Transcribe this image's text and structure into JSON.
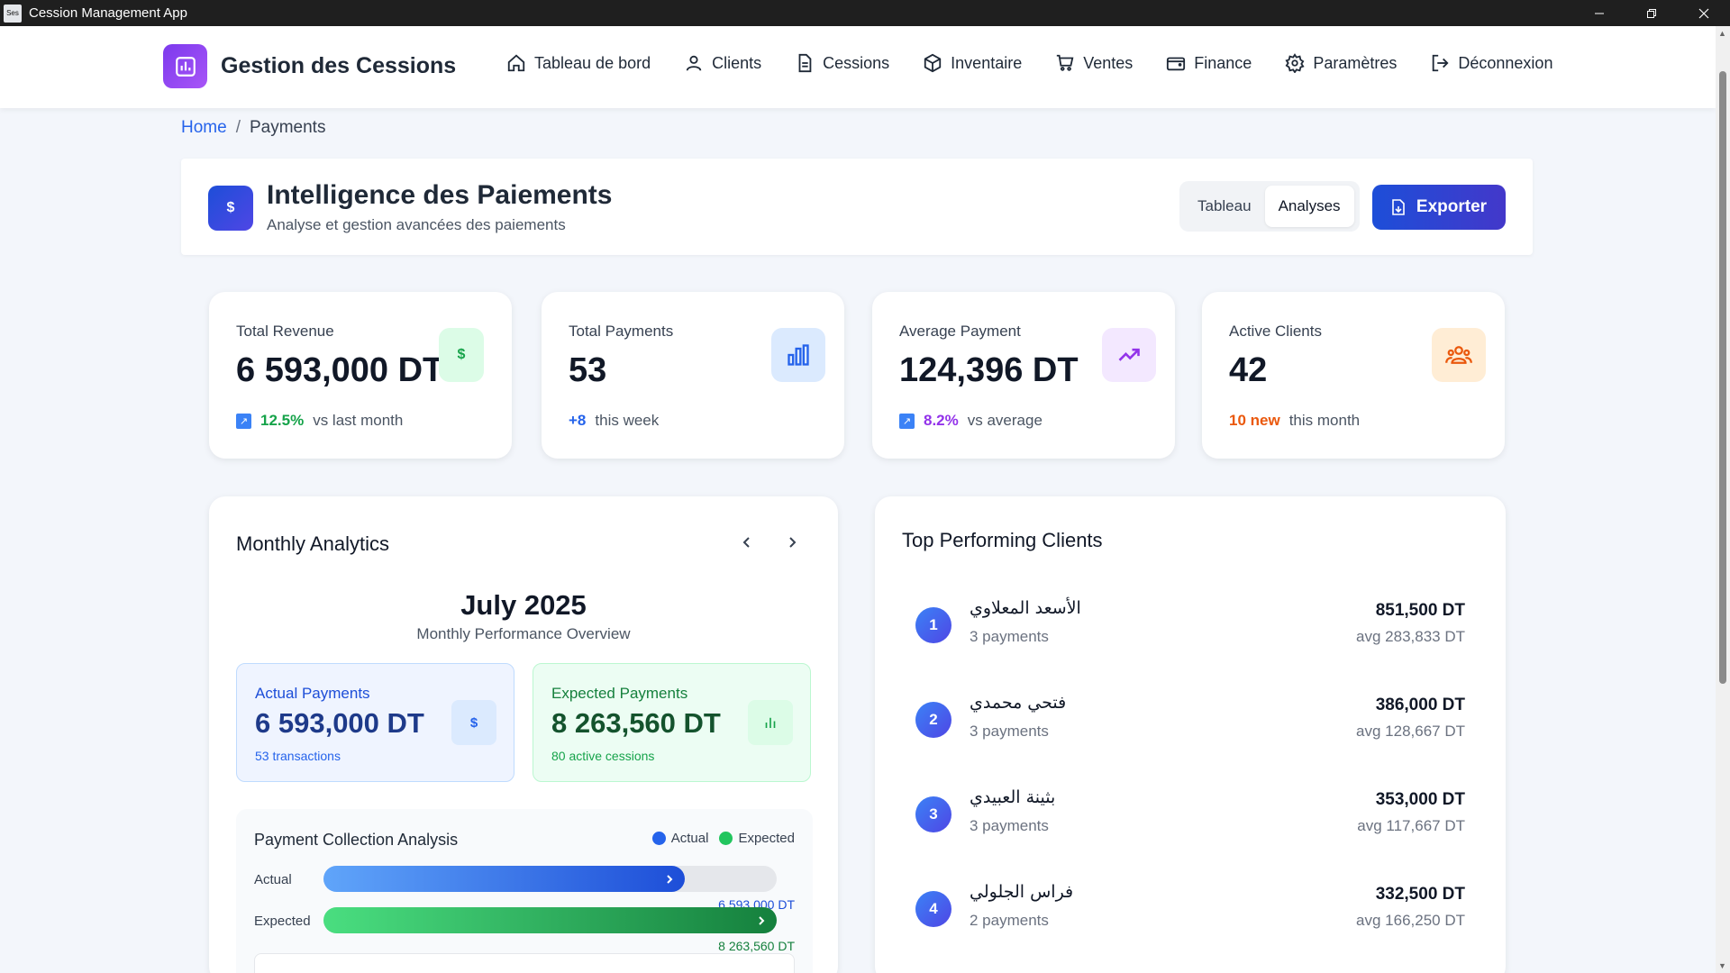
{
  "window": {
    "title": "Cession Management App",
    "icon_text": "Ses"
  },
  "brand": {
    "name": "Gestion des Cessions"
  },
  "nav": [
    {
      "label": "Tableau de bord",
      "icon": "home-icon"
    },
    {
      "label": "Clients",
      "icon": "users-icon"
    },
    {
      "label": "Cessions",
      "icon": "document-icon"
    },
    {
      "label": "Inventaire",
      "icon": "box-icon"
    },
    {
      "label": "Ventes",
      "icon": "cart-icon"
    },
    {
      "label": "Finance",
      "icon": "wallet-icon"
    },
    {
      "label": "Paramètres",
      "icon": "gear-icon"
    },
    {
      "label": "Déconnexion",
      "icon": "logout-icon"
    }
  ],
  "breadcrumb": {
    "home": "Home",
    "sep": "/",
    "current": "Payments"
  },
  "page": {
    "icon": "$",
    "title": "Intelligence des Paiements",
    "subtitle": "Analyse et gestion avancées des paiements",
    "view_toggle": [
      "Tableau",
      "Analyses"
    ],
    "active_view": "Analyses",
    "export_label": "Exporter"
  },
  "stats": [
    {
      "label": "Total Revenue",
      "value": "6 593,000 DT",
      "trend": "12.5%",
      "trend_text": "vs last month",
      "icon_text": "$",
      "accent": "#16a34a"
    },
    {
      "label": "Total Payments",
      "value": "53",
      "trend": "+8",
      "trend_text": "this week",
      "accent": "#2563eb"
    },
    {
      "label": "Average Payment",
      "value": "124,396 DT",
      "trend": "8.2%",
      "trend_text": "vs average",
      "accent": "#9333ea"
    },
    {
      "label": "Active Clients",
      "value": "42",
      "trend": "10 new",
      "trend_text": "this month",
      "accent": "#ea580c"
    }
  ],
  "monthly": {
    "title": "Monthly Analytics",
    "month": "July 2025",
    "subtitle": "Monthly Performance Overview",
    "actual": {
      "label": "Actual Payments",
      "value": "6 593,000 DT",
      "sub": "53 transactions",
      "icon_text": "$"
    },
    "expected": {
      "label": "Expected Payments",
      "value": "8 263,560 DT",
      "sub": "80 active cessions"
    },
    "collection": {
      "title": "Payment Collection Analysis",
      "legend": [
        "Actual",
        "Expected"
      ],
      "rows": [
        {
          "label": "Actual",
          "value": "6 593,000 DT",
          "fraction": 0.798,
          "color": "#1d4ed8"
        },
        {
          "label": "Expected",
          "value": "8 263,560 DT",
          "fraction": 1.0,
          "color": "#15803d"
        }
      ]
    }
  },
  "top_clients": {
    "title": "Top Performing Clients",
    "items": [
      {
        "rank": "1",
        "name": "الأسعد المعلاوي",
        "payments": "3 payments",
        "amount": "851,500 DT",
        "avg": "avg 283,833 DT"
      },
      {
        "rank": "2",
        "name": "فتحي محمدي",
        "payments": "3 payments",
        "amount": "386,000 DT",
        "avg": "avg 128,667 DT"
      },
      {
        "rank": "3",
        "name": "بثينة العبيدي",
        "payments": "3 payments",
        "amount": "353,000 DT",
        "avg": "avg 117,667 DT"
      },
      {
        "rank": "4",
        "name": "فراس الجلولي",
        "payments": "2 payments",
        "amount": "332,500 DT",
        "avg": "avg 166,250 DT"
      }
    ]
  }
}
